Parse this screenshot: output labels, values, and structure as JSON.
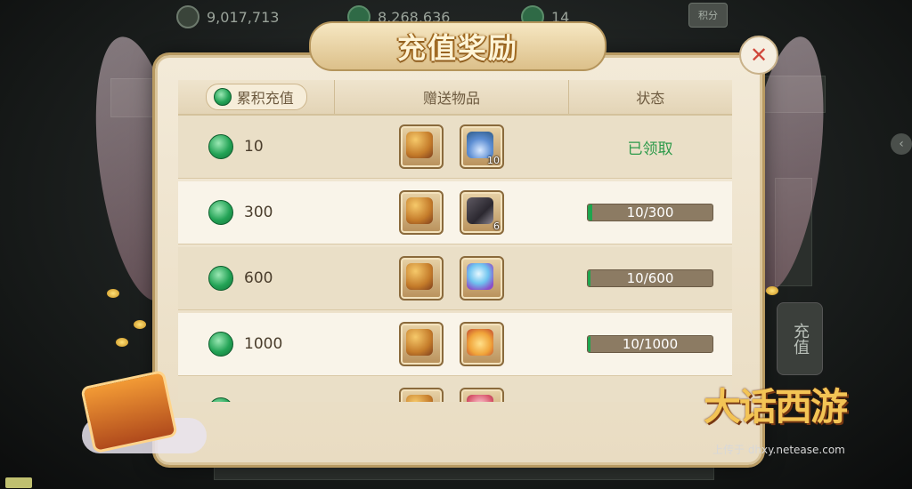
{
  "currency_bar": {
    "silver": "9,017,713",
    "jade_total": "8,268,636",
    "jade_small": "14",
    "points_label": "积分"
  },
  "dialog": {
    "title": "充值奖励",
    "headers": {
      "cumulative": "累积充值",
      "gifts": "赠送物品",
      "status": "状态"
    }
  },
  "rows": [
    {
      "amount": "10",
      "items": [
        {
          "icon": "moneybag-silver-icon",
          "qty": ""
        },
        {
          "icon": "plant-vase-icon",
          "qty": "10"
        }
      ],
      "status_text": "已领取",
      "progress": null
    },
    {
      "amount": "300",
      "items": [
        {
          "icon": "moneybag-silver-icon",
          "qty": ""
        },
        {
          "icon": "dark-stone-icon",
          "qty": "6"
        }
      ],
      "status_text": "10/300",
      "progress": 0.0333
    },
    {
      "amount": "600",
      "items": [
        {
          "icon": "moneybag-silver-icon",
          "qty": ""
        },
        {
          "icon": "crystal-orb-icon",
          "qty": ""
        }
      ],
      "status_text": "10/600",
      "progress": 0.0167
    },
    {
      "amount": "1000",
      "items": [
        {
          "icon": "moneybag-silver-icon",
          "qty": ""
        },
        {
          "icon": "gift-bag-icon",
          "qty": ""
        }
      ],
      "status_text": "10/1000",
      "progress": 0.01
    },
    {
      "amount": "",
      "items": [
        {
          "icon": "moneybag-silver-icon",
          "qty": ""
        },
        {
          "icon": "red-gift-icon",
          "qty": ""
        }
      ],
      "status_text": "",
      "progress": null
    }
  ],
  "side": {
    "recharge_label": "充值"
  },
  "branding": {
    "logo_text": "大话西游",
    "watermark": "上传于 dhxy.netease.com"
  },
  "colors": {
    "claimed_green": "#2c9a4a",
    "progress_green": "#1ea54e",
    "title_gold": "#fff4d6"
  }
}
